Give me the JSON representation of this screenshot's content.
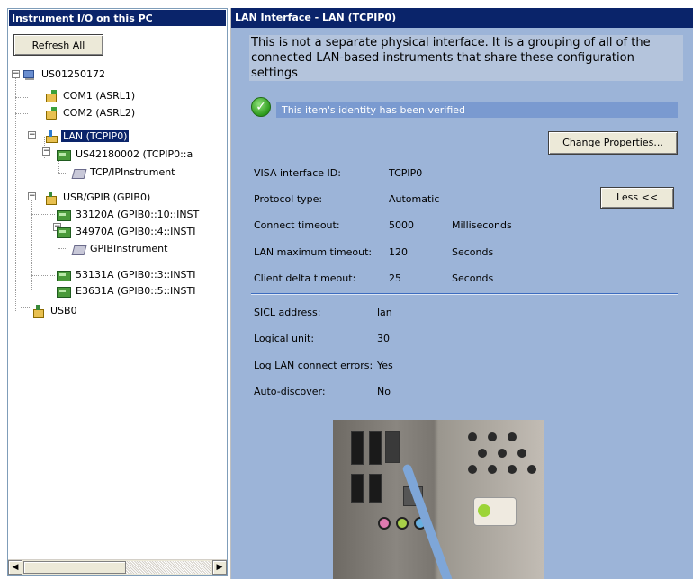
{
  "left_pane": {
    "title": "Instrument I/O on this PC",
    "refresh_button": "Refresh All",
    "tree": [
      {
        "label": "US01250172",
        "icon": "pc-icon"
      },
      {
        "label": "COM1 (ASRL1)",
        "icon": "com-port-icon"
      },
      {
        "label": "COM2 (ASRL2)",
        "icon": "com-port-icon"
      },
      {
        "label": "LAN (TCPIP0)",
        "icon": "lan-interface-icon",
        "selected": true
      },
      {
        "label": "US42180002 (TCPIP0::a",
        "icon": "instrument-icon"
      },
      {
        "label": "TCP/IPInstrument",
        "icon": "visa-device-icon"
      },
      {
        "label": "USB/GPIB (GPIB0)",
        "icon": "usb-gpib-icon"
      },
      {
        "label": "33120A (GPIB0::10::INST",
        "icon": "instrument-icon"
      },
      {
        "label": "34970A (GPIB0::4::INSTI",
        "icon": "instrument-icon"
      },
      {
        "label": "GPIBInstrument",
        "icon": "visa-device-icon"
      },
      {
        "label": "53131A (GPIB0::3::INSTI",
        "icon": "instrument-icon"
      },
      {
        "label": "E3631A (GPIB0::5::INSTI",
        "icon": "instrument-icon"
      },
      {
        "label": "USB0",
        "icon": "usb-interface-icon"
      }
    ]
  },
  "right_pane": {
    "title": "LAN Interface - LAN (TCPIP0)",
    "description": "This is not a separate physical interface. It is a grouping of all of the connected LAN-based instruments that share these configuration settings",
    "verified_text": "This item's identity has been verified",
    "change_properties_button": "Change Properties...",
    "less_button": "Less <<",
    "properties": [
      {
        "label": "VISA interface ID:",
        "value": "TCPIP0",
        "unit": ""
      },
      {
        "label": "Protocol type:",
        "value": "Automatic",
        "unit": ""
      },
      {
        "label": "Connect timeout:",
        "value": "5000",
        "unit": "Milliseconds"
      },
      {
        "label": "LAN maximum timeout:",
        "value": "120",
        "unit": "Seconds"
      },
      {
        "label": "Client delta timeout:",
        "value": "25",
        "unit": "Seconds"
      }
    ],
    "sicl_properties": [
      {
        "label": "SICL address:",
        "value": "lan"
      },
      {
        "label": "Logical unit:",
        "value": "30"
      },
      {
        "label": "Log LAN connect errors:",
        "value": "Yes"
      },
      {
        "label": "Auto-discover:",
        "value": "No"
      }
    ],
    "colors": {
      "panel_bg": "#9cb4d8",
      "title_bg": "#0a246a",
      "check_green": "#2c9a1c"
    }
  }
}
